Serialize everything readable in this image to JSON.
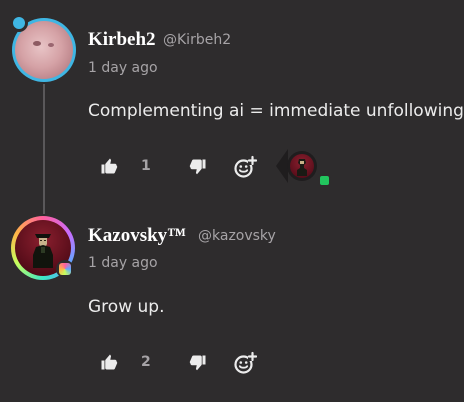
{
  "comments": [
    {
      "author": "Kirbeh2",
      "handle": "@Kirbeh2",
      "time": "1 day ago",
      "text": "Complementing ai = immediate unfollowing",
      "likes": "1"
    },
    {
      "author": "Kazovsky™",
      "handle": "@kazovsky",
      "time": "1 day ago",
      "text": "Grow up.",
      "likes": "2"
    }
  ],
  "colors": {
    "background": "#2e2c2d",
    "text": "#ececec",
    "muted": "#a6a3a6",
    "avatar_ring_1": "#3fb6e3",
    "online_badge": "#22c55e"
  },
  "icons": {
    "like": "thumbs-up-icon",
    "dislike": "thumbs-down-icon",
    "react": "add-reaction-icon"
  }
}
